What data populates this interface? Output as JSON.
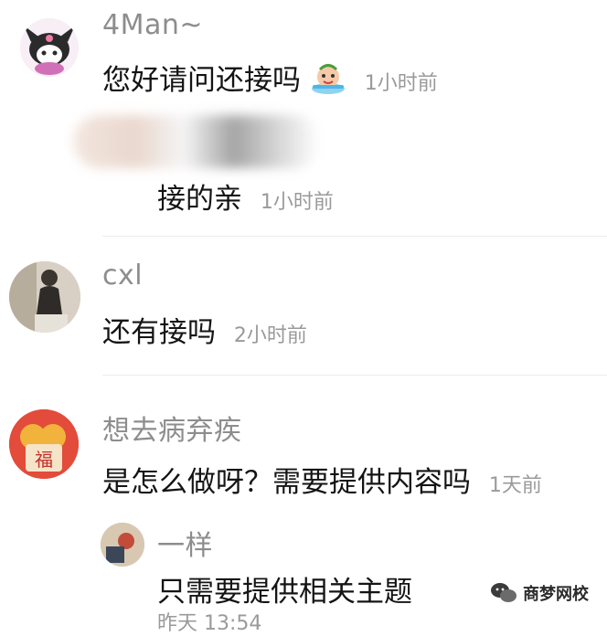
{
  "comments": [
    {
      "username": "4Man~",
      "text": "您好请问还接吗",
      "time": "1小时前",
      "emoji": "crying-face-icon"
    },
    {
      "reply_text": "接的亲",
      "reply_time": "1小时前"
    },
    {
      "username": "cxl",
      "text": "还有接吗",
      "time": "2小时前"
    },
    {
      "username": "想去病弃疾",
      "text": "是怎么做呀？需要提供内容吗",
      "time": "1天前"
    },
    {
      "username": "一样",
      "text": "只需要提供相关主题",
      "time": "昨天 13:54"
    }
  ],
  "watermark": {
    "text": "商梦网校",
    "icon": "wechat-icon"
  }
}
